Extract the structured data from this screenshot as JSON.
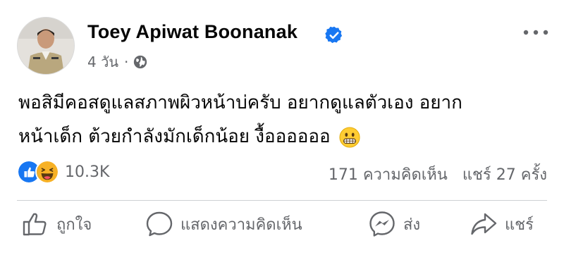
{
  "post": {
    "author": "Toey Apiwat Boonanak",
    "timestamp": "4 วัน",
    "separator": "·",
    "privacy_icon": "globe-icon",
    "verified_icon": "verified-badge-icon",
    "text_line1": "พอสิมีคอสดูแลสภาพผิวหน้าบ่ครับ อยากดูแลตัวเอง อยาก",
    "text_line2": "หน้าเด็ก ต้วยกำลังมักเด็กน้อย งื้ออออออ",
    "emoji": "grimacing-face-emoji"
  },
  "stats": {
    "reaction_icons": [
      "like-reaction-icon",
      "haha-reaction-icon"
    ],
    "reaction_count": "10.3K",
    "comments": "171 ความคิดเห็น",
    "shares": "แชร์ 27 ครั้ง"
  },
  "actions": {
    "like": "ถูกใจ",
    "comment": "แสดงความคิดเห็น",
    "send": "ส่ง",
    "share": "แชร์"
  },
  "colors": {
    "accent": "#1877f2",
    "secondary_text": "#65676b",
    "primary_text": "#050505",
    "divider": "#ced0d4",
    "haha": "#f7b125"
  }
}
